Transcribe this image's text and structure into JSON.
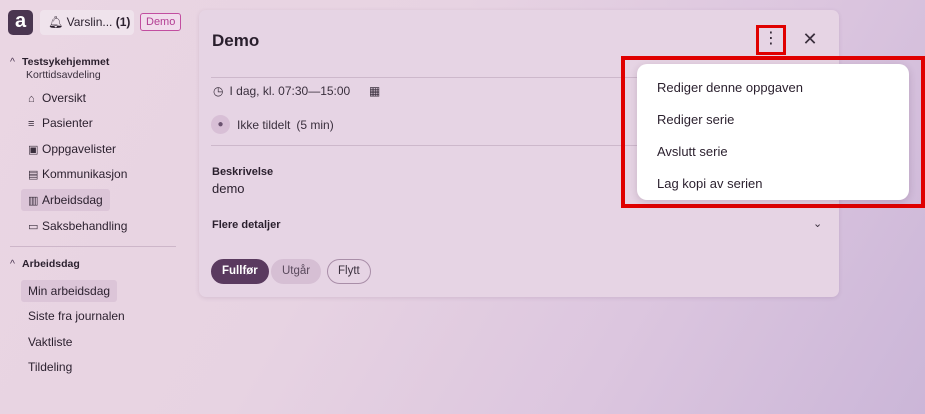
{
  "app": {
    "logo_letter": "a",
    "alert_label": "Varslin...",
    "alert_count": "(1)",
    "env_badge": "Demo"
  },
  "sidebar": {
    "section1": {
      "title": "Testsykehjemmet",
      "subtitle": "Korttidsavdeling",
      "items": [
        {
          "label": "Oversikt",
          "icon": "home-icon"
        },
        {
          "label": "Pasienter",
          "icon": "patients-icon"
        },
        {
          "label": "Oppgavelister",
          "icon": "clipboard-icon"
        },
        {
          "label": "Kommunikasjon",
          "icon": "message-icon"
        },
        {
          "label": "Arbeidsdag",
          "icon": "briefcase-icon",
          "active": true
        },
        {
          "label": "Saksbehandling",
          "icon": "folder-icon"
        }
      ]
    },
    "section2": {
      "title": "Arbeidsdag",
      "items": [
        {
          "label": "Min arbeidsdag",
          "active": true
        },
        {
          "label": "Siste fra journalen"
        },
        {
          "label": "Vaktliste"
        },
        {
          "label": "Tildeling"
        }
      ]
    }
  },
  "task": {
    "title": "Demo",
    "time": "I dag, kl. 07:30—15:00",
    "assignee": "Ikke tildelt",
    "duration": "(5 min)",
    "description_label": "Beskrivelse",
    "description": "demo",
    "more_details": "Flere detaljer",
    "buttons": {
      "complete": "Fullfør",
      "expire": "Utgår",
      "move": "Flytt"
    }
  },
  "menu": {
    "items": [
      "Rediger denne oppgaven",
      "Rediger serie",
      "Avslutt serie",
      "Lag kopi av serien"
    ]
  },
  "colors": {
    "primary": "#5a3a5f",
    "highlight": "#e00000",
    "badge": "#c24ea0"
  }
}
